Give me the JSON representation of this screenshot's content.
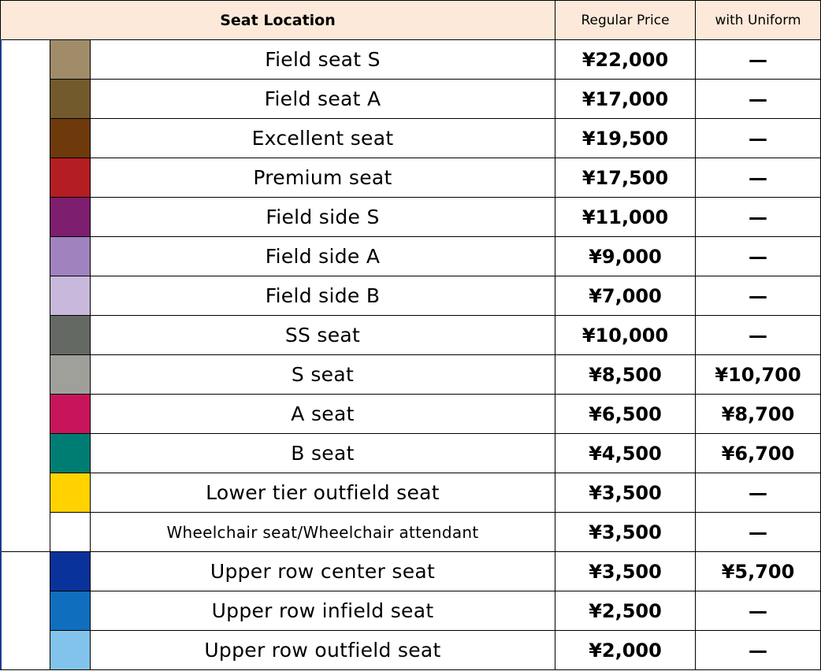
{
  "header": {
    "seat_location": "Seat Location",
    "regular_price": "Regular Price",
    "with_uniform": "with Uniform"
  },
  "rows": [
    {
      "name": "Field seat S",
      "color": "#a08c69",
      "price": "¥22,000",
      "uniform": "—"
    },
    {
      "name": "Field seat A",
      "color": "#735a2d",
      "price": "¥17,000",
      "uniform": "—"
    },
    {
      "name": "Excellent seat",
      "color": "#6e3a0b",
      "price": "¥19,500",
      "uniform": "—"
    },
    {
      "name": "Premium seat",
      "color": "#b41e23",
      "price": "¥17,500",
      "uniform": "—"
    },
    {
      "name": "Field side S",
      "color": "#7d1e6e",
      "price": "¥11,000",
      "uniform": "—"
    },
    {
      "name": "Field side A",
      "color": "#a082be",
      "price": "¥9,000",
      "uniform": "—"
    },
    {
      "name": "Field side B",
      "color": "#c8b9dc",
      "price": "¥7,000",
      "uniform": "—"
    },
    {
      "name": "SS seat",
      "color": "#646964",
      "price": "¥10,000",
      "uniform": "—"
    },
    {
      "name": "S seat",
      "color": "#a0a09b",
      "price": "¥8,500",
      "uniform": "¥10,700"
    },
    {
      "name": "A seat",
      "color": "#c8145a",
      "price": "¥6,500",
      "uniform": "¥8,700"
    },
    {
      "name": "B seat",
      "color": "#007d73",
      "price": "¥4,500",
      "uniform": "¥6,700"
    },
    {
      "name": "Lower tier outfield seat",
      "color": "#ffd200",
      "price": "¥3,500",
      "uniform": "—"
    },
    {
      "name": "Wheelchair seat/Wheelchair attendant",
      "color": "#ffffff",
      "price": "¥3,500",
      "uniform": "—"
    },
    {
      "name": "Upper row center seat",
      "color": "#0a329b",
      "price": "¥3,500",
      "uniform": "¥5,700"
    },
    {
      "name": "Upper row infield seat",
      "color": "#0f6ebe",
      "price": "¥2,500",
      "uniform": "—"
    },
    {
      "name": "Upper row outfield seat",
      "color": "#82c3eb",
      "price": "¥2,000",
      "uniform": "—"
    }
  ]
}
